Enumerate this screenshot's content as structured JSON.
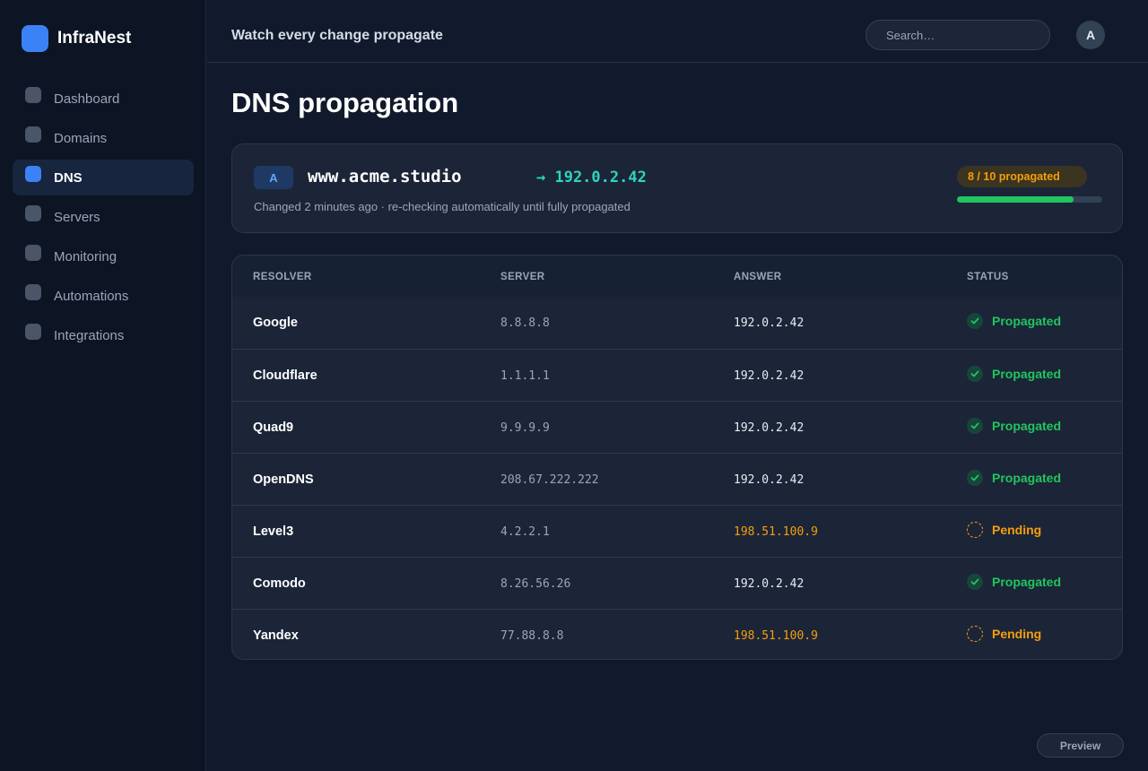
{
  "app": {
    "name": "InfraNest"
  },
  "sidebar": {
    "items": [
      {
        "label": "Dashboard",
        "icon": "dashboard-icon",
        "active": false
      },
      {
        "label": "Domains",
        "icon": "domains-icon",
        "active": false
      },
      {
        "label": "DNS",
        "icon": "dns-icon",
        "active": true
      },
      {
        "label": "Servers",
        "icon": "servers-icon",
        "active": false
      },
      {
        "label": "Monitoring",
        "icon": "monitoring-icon",
        "active": false
      },
      {
        "label": "Automations",
        "icon": "automations-icon",
        "active": false
      },
      {
        "label": "Integrations",
        "icon": "integrations-icon",
        "active": false
      }
    ]
  },
  "header": {
    "title": "Watch every change propagate",
    "search_placeholder": "Search…",
    "avatar_initial": "A"
  },
  "main": {
    "title": "DNS propagation",
    "record": {
      "type": "A",
      "host": "www.acme.studio",
      "target": "→ 192.0.2.42",
      "subtitle": "Changed 2 minutes ago · re-checking automatically until fully propagated",
      "progress_label": "8 / 10 propagated",
      "progress_fraction": 0.8
    },
    "table": {
      "columns": [
        "RESOLVER",
        "SERVER",
        "ANSWER",
        "STATUS"
      ],
      "rows": [
        {
          "resolver": "Google",
          "server": "8.8.8.8",
          "answer": "192.0.2.42",
          "status": "Propagated",
          "state": "ok"
        },
        {
          "resolver": "Cloudflare",
          "server": "1.1.1.1",
          "answer": "192.0.2.42",
          "status": "Propagated",
          "state": "ok"
        },
        {
          "resolver": "Quad9",
          "server": "9.9.9.9",
          "answer": "192.0.2.42",
          "status": "Propagated",
          "state": "ok"
        },
        {
          "resolver": "OpenDNS",
          "server": "208.67.222.222",
          "answer": "192.0.2.42",
          "status": "Propagated",
          "state": "ok"
        },
        {
          "resolver": "Level3",
          "server": "4.2.2.1",
          "answer": "198.51.100.9",
          "status": "Pending",
          "state": "pending"
        },
        {
          "resolver": "Comodo",
          "server": "8.26.56.26",
          "answer": "192.0.2.42",
          "status": "Propagated",
          "state": "ok"
        },
        {
          "resolver": "Yandex",
          "server": "77.88.8.8",
          "answer": "198.51.100.9",
          "status": "Pending",
          "state": "pending"
        }
      ]
    }
  },
  "footer": {
    "preview_label": "Preview"
  },
  "colors": {
    "accent": "#3b82f6",
    "success": "#22c55e",
    "pending": "#f59e0b",
    "target": "#2dd4bf"
  }
}
